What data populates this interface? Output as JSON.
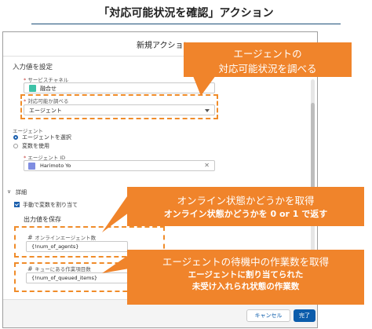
{
  "slide": {
    "title": "「対応可能状況を確認」アクション"
  },
  "modal": {
    "title": "新規アクション",
    "input_section": "入力値を設定",
    "service_channel": {
      "label": "サービスチャネル",
      "value": "融合せ"
    },
    "check_availability": {
      "label": "対応可能か調べる",
      "value": "エージェント"
    },
    "agent_group": {
      "label": "エージェント",
      "radio_select": "エージェントを選択",
      "radio_variable": "変数を使用"
    },
    "agent_id": {
      "label": "エージェント ID",
      "value": "Harimoto Yo"
    },
    "details": {
      "label": "詳細",
      "manual_assign": "手動で変数を割り当て",
      "output_title": "出力値を保存",
      "online_agents": {
        "label": "オンラインエージェント数",
        "value": "{!num_of_agents}"
      },
      "queued_items": {
        "label": "キューにある作業項目数",
        "value": "{!num_of_queued_items}"
      }
    },
    "footer": {
      "cancel": "キャンセル",
      "done": "完了"
    }
  },
  "callouts": {
    "check": {
      "line1": "エージェントの",
      "line2": "対応可能状況を調べる"
    },
    "online": {
      "line1": "オンライン状態かどうかを取得",
      "line2": "オンライン状態かどうかを 0 or 1 で返す"
    },
    "queued": {
      "line1": "エージェントの待機中の作業数を取得",
      "line2": "エージェントに割り当てられた",
      "line3": "未受け入れられ状態の作業数"
    }
  },
  "colors": {
    "accent_orange": "#f0842b",
    "brand_blue": "#0b5cab"
  }
}
